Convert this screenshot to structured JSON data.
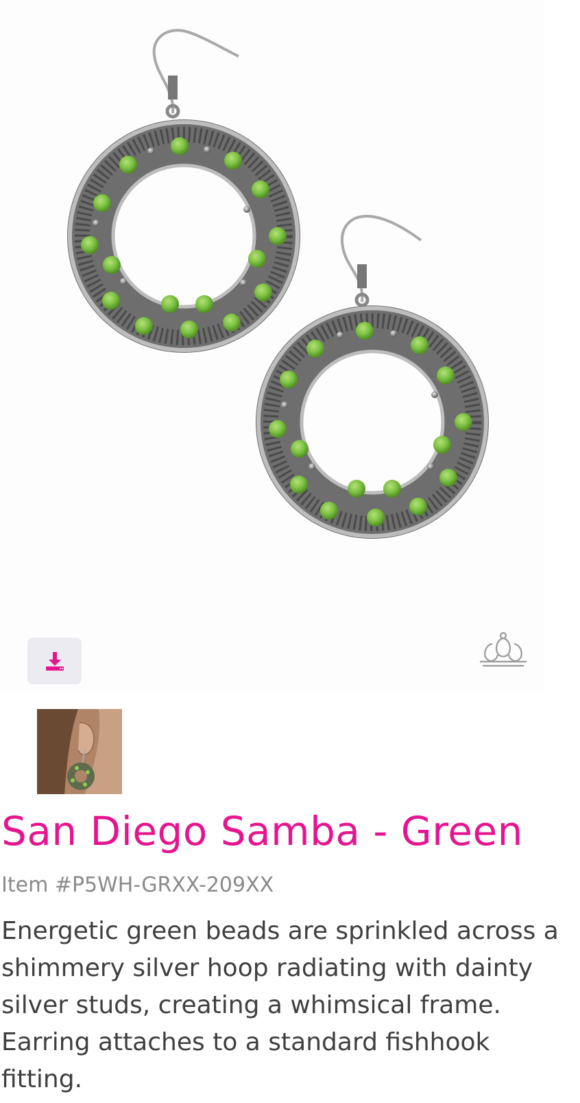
{
  "product": {
    "title": "San Diego Samba - Green",
    "item_number": "Item #P5WH-GRXX-209XX",
    "description": "Energetic green beads are sprinkled across a shimmery silver hoop radiating with dainty silver studs, creating a whimsical frame. Earring attaches to a standard fishhook fitting."
  },
  "icons": {
    "download": "download-icon",
    "brand": "crown-logo-icon"
  },
  "colors": {
    "title": "#e5158f",
    "accent": "#e5158f",
    "bead_green": "#7cc242",
    "metal_silver": "#8c8c8c",
    "item_number": "#8a8a8a",
    "body_text": "#3f3f3f",
    "button_bg": "#ecebf1"
  }
}
